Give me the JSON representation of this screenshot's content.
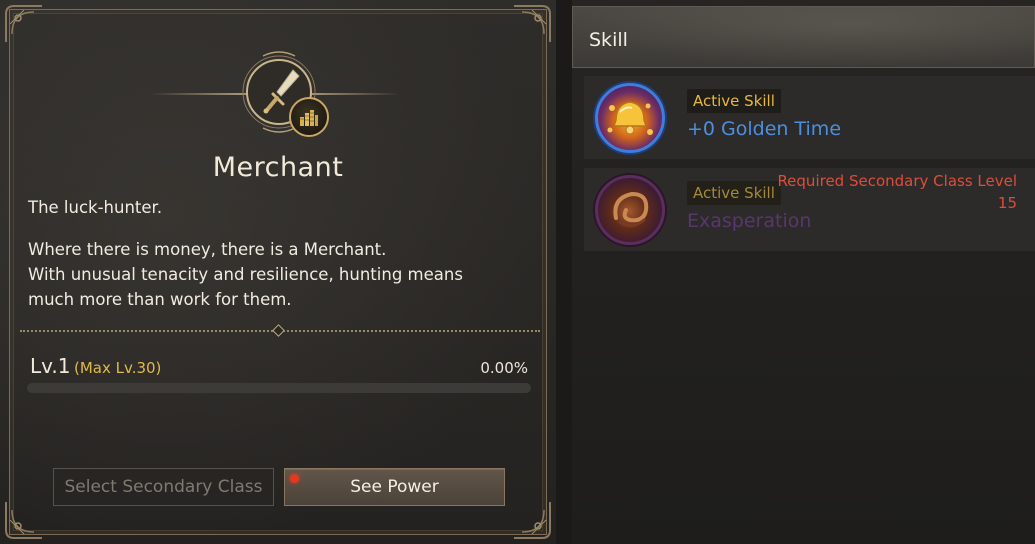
{
  "left": {
    "class_title": "Merchant",
    "tagline": "The luck-hunter.",
    "description": "Where there is money, there is a Merchant.\nWith unusual tenacity and resilience, hunting means much more than work for them.",
    "level_label": "Lv.1",
    "max_level_label": "(Max Lv.30)",
    "exp_percent_label": "0.00%",
    "exp_progress_fraction": 0.0,
    "select_button_label": "Select Secondary Class",
    "power_button_label": "See Power",
    "emblem_icon": "dagger-icon",
    "badge_icon": "gold-coins-icon"
  },
  "right": {
    "header_title": "Skill",
    "skills": [
      {
        "type": "Active Skill",
        "name": "+0 Golden Time",
        "icon": "golden-bell-icon",
        "name_color": "#4a8fe0"
      },
      {
        "type": "Active Skill",
        "name": "Exasperation",
        "icon": "swirl-orb-icon",
        "name_color": "#59366e",
        "requirement_label": "Required Secondary Class Level",
        "requirement_value": "15"
      }
    ]
  },
  "colors": {
    "gold_accent": "#e3b946",
    "requirement_red": "#de4c3a",
    "notification_dot": "#e2391f"
  }
}
